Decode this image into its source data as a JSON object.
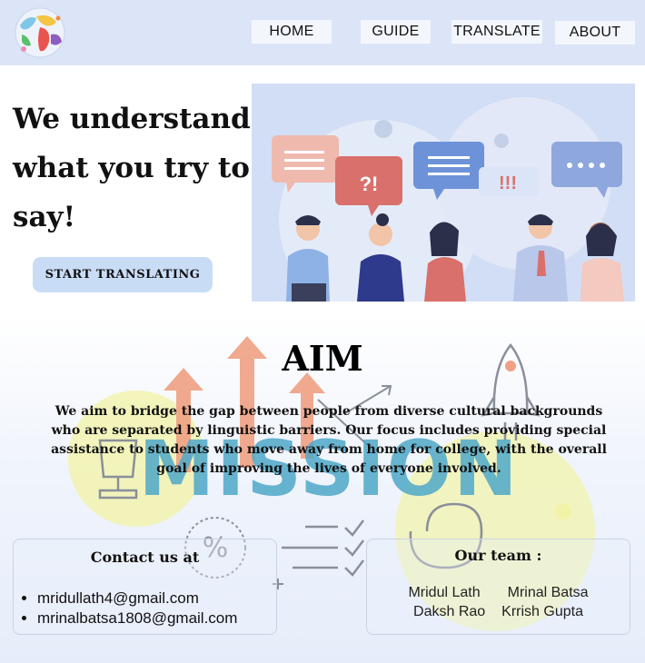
{
  "nav": {
    "logo_icon": "world-map-logo-icon",
    "items": [
      {
        "label": "HOME"
      },
      {
        "label": "GUIDE"
      },
      {
        "label": "TRANSLATE"
      },
      {
        "label": "ABOUT"
      }
    ]
  },
  "hero": {
    "title": "We understand what you try to say!",
    "cta_label": "START TRANSLATING",
    "illustration_icon": "people-conversation-illustration",
    "bubble_texts": [
      "?!",
      "!!!"
    ]
  },
  "mission": {
    "title": "AIM",
    "text": "We aim to bridge the gap between people from diverse cultural backgrounds who are separated by linguistic barriers. Our focus includes providing special assistance to students who move away from home for college, with the overall goal of improving the lives of everyone involved.",
    "background_word": "MISSION"
  },
  "contact": {
    "title": "Contact us at",
    "emails": [
      "mridullath4@gmail.com",
      "mrinalbatsa1808@gmail.com"
    ]
  },
  "team": {
    "title": "Our team :",
    "members": [
      "Mridul Lath",
      "Mrinal Batsa",
      "Daksh Rao",
      "Krrish Gupta"
    ]
  },
  "colors": {
    "navbar_bg": "#dbe5f7",
    "cta_bg": "#c9dcf6",
    "hero_illustration_bg": "#d2def5",
    "accent_orange": "#f0a183",
    "accent_yellow": "#f2f3a6",
    "mission_teal": "#4fa8c9"
  }
}
